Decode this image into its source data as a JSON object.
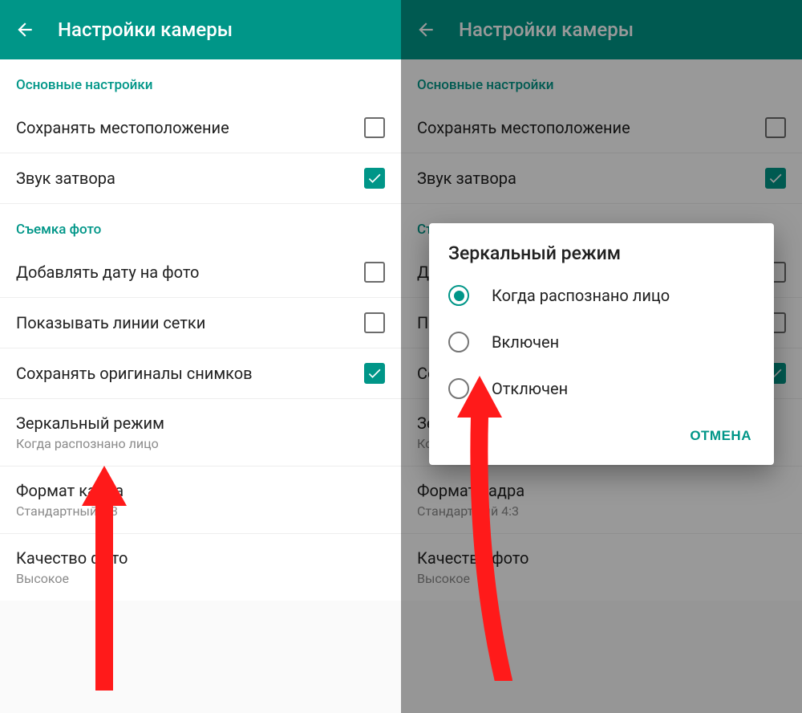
{
  "appbar": {
    "title": "Настройки камеры"
  },
  "sections": {
    "basic": {
      "header": "Основные настройки",
      "saveLocation": {
        "label": "Сохранять местоположение",
        "checked": false
      },
      "shutterSound": {
        "label": "Звук затвора",
        "checked": true
      }
    },
    "photo": {
      "header": "Съемка фото",
      "addDate": {
        "label": "Добавлять дату на фото",
        "checked": false
      },
      "showGrid": {
        "label": "Показывать линии сетки",
        "checked": false
      },
      "saveOrig": {
        "label": "Сохранять оригиналы снимков",
        "checked": true
      },
      "mirror": {
        "label": "Зеркальный режим",
        "value": "Когда распознано лицо"
      },
      "aspect": {
        "label": "Формат кадра",
        "value": "Стандартный 4:3"
      },
      "quality": {
        "label": "Качество фото",
        "value": "Высокое"
      }
    }
  },
  "dialog": {
    "title": "Зеркальный режим",
    "options": {
      "whenFace": "Когда распознано лицо",
      "on": "Включен",
      "off": "Отключен"
    },
    "selected": "whenFace",
    "cancel": "ОТМЕНА"
  }
}
